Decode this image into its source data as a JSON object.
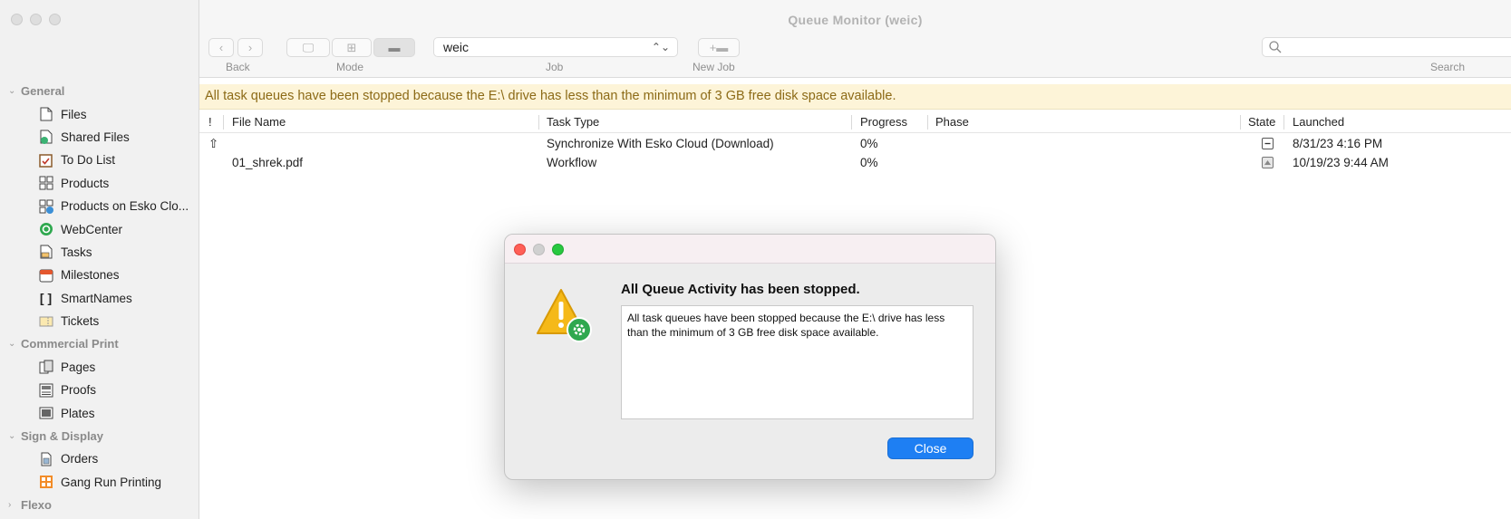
{
  "window": {
    "title": "Queue Monitor (weic)"
  },
  "toolbar": {
    "back_label": "Back",
    "mode_label": "Mode",
    "job_label": "Job",
    "new_job_label": "New Job",
    "search_label": "Search",
    "job_value": "weic"
  },
  "sidebar": {
    "sections": [
      {
        "title": "General",
        "collapsed": false,
        "items": [
          {
            "label": "Files",
            "icon": "file-icon"
          },
          {
            "label": "Shared Files",
            "icon": "shared-files-icon"
          },
          {
            "label": "To Do List",
            "icon": "todo-list-icon"
          },
          {
            "label": "Products",
            "icon": "products-icon"
          },
          {
            "label": "Products on Esko Clo...",
            "icon": "products-cloud-icon"
          },
          {
            "label": "WebCenter",
            "icon": "webcenter-icon"
          },
          {
            "label": "Tasks",
            "icon": "tasks-icon"
          },
          {
            "label": "Milestones",
            "icon": "milestones-icon"
          },
          {
            "label": "SmartNames",
            "icon": "smartnames-icon"
          },
          {
            "label": "Tickets",
            "icon": "tickets-icon"
          }
        ]
      },
      {
        "title": "Commercial Print",
        "collapsed": false,
        "items": [
          {
            "label": "Pages",
            "icon": "pages-icon"
          },
          {
            "label": "Proofs",
            "icon": "proofs-icon"
          },
          {
            "label": "Plates",
            "icon": "plates-icon"
          }
        ]
      },
      {
        "title": "Sign & Display",
        "collapsed": false,
        "items": [
          {
            "label": "Orders",
            "icon": "orders-icon"
          },
          {
            "label": "Gang Run Printing",
            "icon": "gang-run-icon"
          }
        ]
      },
      {
        "title": "Flexo",
        "collapsed": true,
        "items": []
      }
    ]
  },
  "banner": {
    "text": "All task queues have been stopped because the E:\\ drive has less than the minimum of 3 GB free disk space available."
  },
  "table": {
    "columns": {
      "priority": "!",
      "file_name": "File Name",
      "task_type": "Task Type",
      "progress": "Progress",
      "phase": "Phase",
      "state": "State",
      "launched": "Launched"
    },
    "rows": [
      {
        "priority": "⇧",
        "file_name": "",
        "task_type": "Synchronize With Esko Cloud (Download)",
        "progress": "0%",
        "phase": "",
        "state": "minus-state-icon",
        "launched": "8/31/23 4:16 PM"
      },
      {
        "priority": "",
        "file_name": "01_shrek.pdf",
        "task_type": "Workflow",
        "progress": "0%",
        "phase": "",
        "state": "waiting-state-icon",
        "launched": "10/19/23 9:44 AM"
      }
    ]
  },
  "dialog": {
    "heading": "All Queue Activity has been stopped.",
    "message": "All task queues have been stopped because the E:\\ drive has less than the minimum of 3 GB free disk space available.",
    "close_label": "Close"
  },
  "colors": {
    "banner_bg": "#fdf4d8",
    "banner_text": "#8c6a16",
    "primary_button": "#1e7ff3",
    "close_dot": "#ff5f57",
    "minimize_dot": "#d0d0d0",
    "zoom_dot": "#28c840"
  }
}
